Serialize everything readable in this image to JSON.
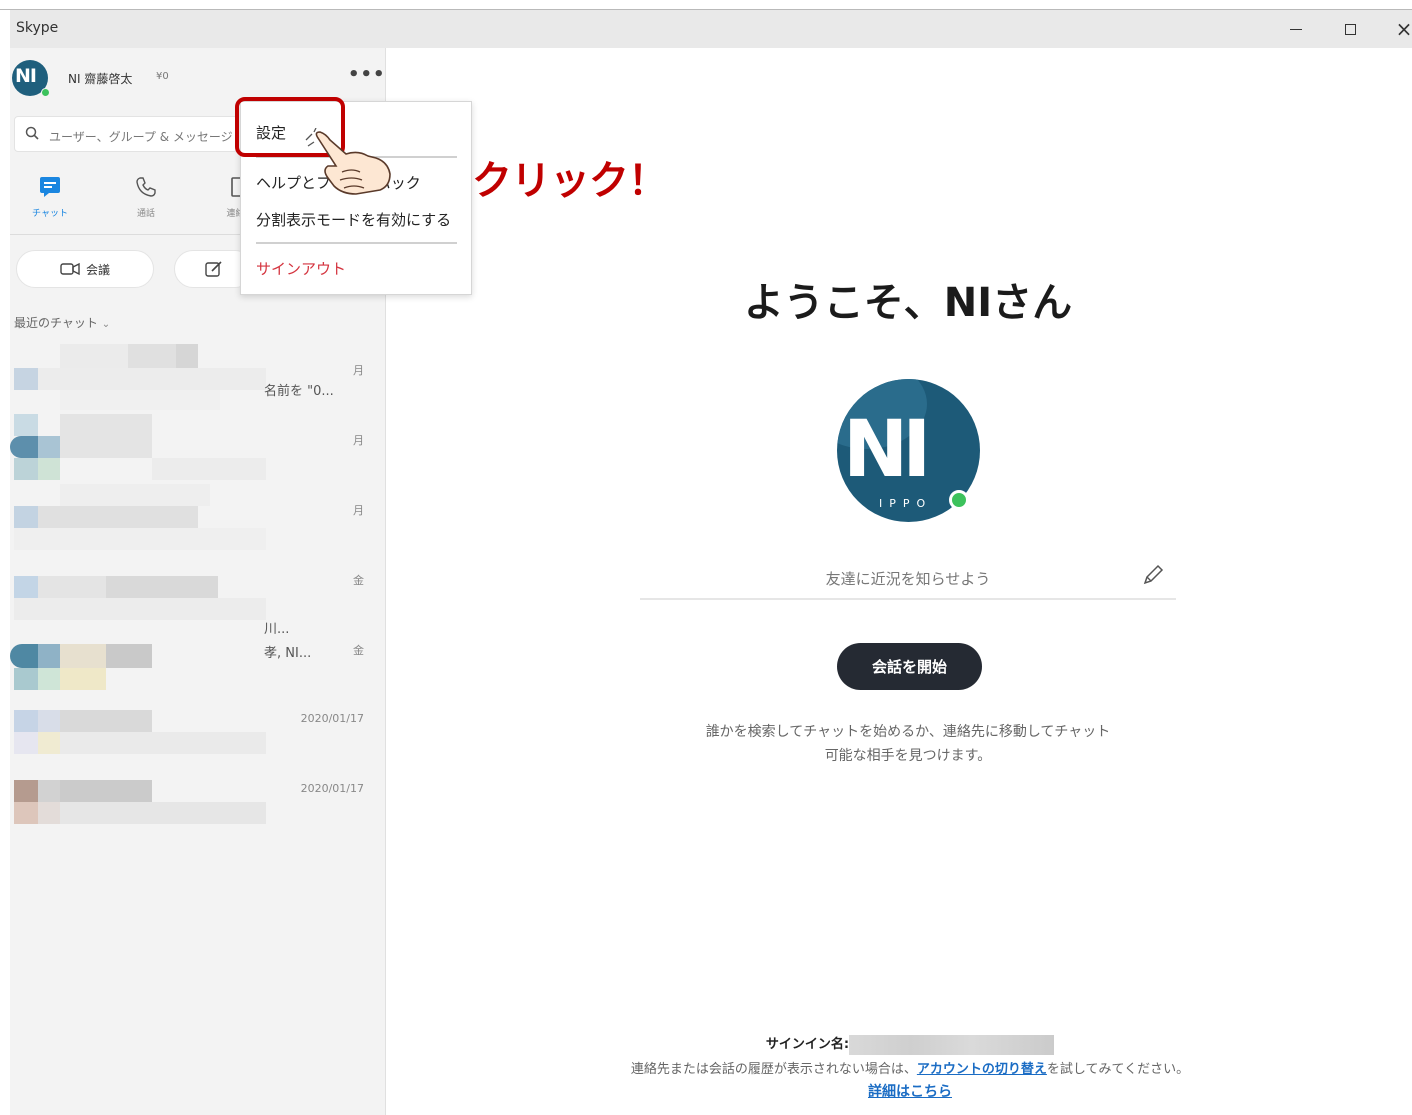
{
  "window": {
    "title": "Skype",
    "controls": {
      "minimize": "minimize-icon",
      "maximize": "maximize-icon",
      "close": "×"
    }
  },
  "profile": {
    "name": "NI 齋藤啓太",
    "balance": "¥0",
    "avatar_letters": "NI",
    "more": "•••",
    "status_color": "#3cc25c"
  },
  "search": {
    "placeholder": "ユーザー、グループ & メッセージ"
  },
  "nav": {
    "chat": "チャット",
    "calls": "通話",
    "contacts": "連絡先",
    "active_color": "#1a86e0"
  },
  "actions": {
    "meet": "会議",
    "new_chat_icon": "compose-icon"
  },
  "recent": {
    "header": "最近のチャット"
  },
  "chats": [
    {
      "snippet": "名前を \"0...",
      "time": "月"
    },
    {
      "snippet": "",
      "time": "月"
    },
    {
      "snippet": "",
      "time": "月"
    },
    {
      "snippet": "川...",
      "snippet2": "孝, NI...",
      "time": "金"
    },
    {
      "snippet": "",
      "time": "金"
    },
    {
      "snippet": "",
      "time": "2020/01/17"
    },
    {
      "snippet": "",
      "time": "2020/01/17"
    }
  ],
  "menu": {
    "settings": "設定",
    "help": "ヘルプとフィードバック",
    "split": "分割表示モードを有効にする",
    "signout": "サインアウト",
    "signout_color": "#d4343f"
  },
  "annotation": {
    "click": "クリック！",
    "color": "#c00000"
  },
  "main": {
    "welcome": "ようこそ、NIさん",
    "avatar_letters": "NI",
    "avatar_sub": "IPPO",
    "mood_placeholder": "友達に近況を知らせよう",
    "start_button": "会話を開始",
    "desc_line1": "誰かを検索してチャットを始めるか、連絡先に移動してチャット",
    "desc_line2": "可能な相手を見つけます。",
    "signin_label": "サインイン名:",
    "footer_pre": "連絡先または会話の履歴が表示されない場合は、",
    "footer_link": "アカウントの切り替え",
    "footer_post": "を試してみてください。",
    "more_link": "詳細はこちら"
  }
}
